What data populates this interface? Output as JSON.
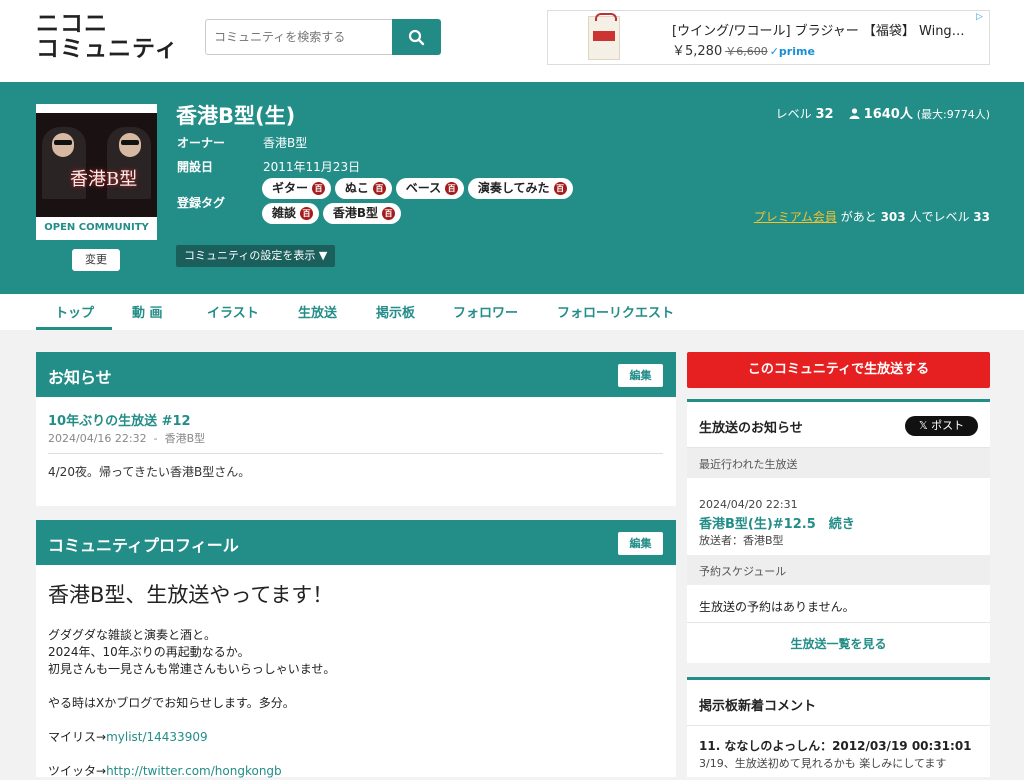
{
  "logo": {
    "line1": "ニコニ",
    "line2": "コミュニティ"
  },
  "search": {
    "placeholder": "コミュニティを検索する"
  },
  "ad": {
    "title": "[ウイング/ワコール] ブラジャー 【福袋】 Wing…",
    "price": "￥5,280",
    "original_price": "￥6,600",
    "prime": "✓prime"
  },
  "community": {
    "name": "香港B型(生)",
    "thumb_title": "香港B型",
    "thumb_caption": "OPEN COMMUNITY",
    "change_label": "変更",
    "owner_label": "オーナー",
    "owner": "香港B型",
    "founded_label": "開設日",
    "founded": "2011年11月23日",
    "tags_label": "登録タグ",
    "tags": [
      "ギター",
      "ぬこ",
      "ベース",
      "演奏してみた",
      "雑談",
      "香港B型"
    ],
    "tag_dict_glyph": "百",
    "settings_label": "コミュニティの設定を表示 ▼",
    "level_label": "レベル",
    "level": "32",
    "members": "1640",
    "members_unit": "人",
    "members_max": "(最大:9774人)",
    "premium_link": "プレミアム会員",
    "premium_text_a": "があと",
    "premium_count": "303",
    "premium_text_b": "人でレベル",
    "premium_next_level": "33"
  },
  "tabs": [
    "トップ",
    "動 画",
    "イラスト",
    "生放送",
    "掲示板",
    "フォロワー",
    "フォローリクエスト"
  ],
  "notice": {
    "header": "お知らせ",
    "edit": "編集",
    "title": "10年ぶりの生放送 #12",
    "date": "2024/04/16 22:32",
    "author": "香港B型",
    "body": "4/20夜。帰ってきたい香港B型さん。"
  },
  "profile": {
    "header": "コミュニティプロフィール",
    "edit": "編集",
    "headline": "香港B型、生放送やってます！",
    "lines": [
      "グダグダな雑談と演奏と酒と。",
      "2024年、10年ぶりの再起動なるか。",
      "初見さんも一見さんも常連さんもいらっしゃいませ。"
    ],
    "line_x": "やる時はXかブログでお知らせします。多分。",
    "mylist_prefix": "マイリス→",
    "mylist_link": "mylist/14433909",
    "twitter_prefix": "ツイッタ→",
    "twitter_link": "http://twitter.com/hongkongb"
  },
  "sidebar": {
    "live_button": "このコミュニティで生放送する",
    "live_notice_header": "生放送のお知らせ",
    "x_post": "𝕏 ポスト",
    "recent_label": "最近行われた生放送",
    "recent_date": "2024/04/20 22:31",
    "recent_title": "香港B型(生)#12.5　続き",
    "recent_by": "放送者：香港B型",
    "schedule_label": "予約スケジュール",
    "schedule_body": "生放送の予約はありません。",
    "schedule_link": "生放送一覧を見る",
    "bbs_header": "掲示板新着コメント",
    "bbs_item_title": "11. ななしのよっしん：2012/03/19 00:31:01",
    "bbs_item_body": "3/19、生放送初めて見れるかも 楽しみにしてます"
  },
  "colors": {
    "accent": "#238d88",
    "live": "#e62020",
    "premium": "#f1c232"
  }
}
